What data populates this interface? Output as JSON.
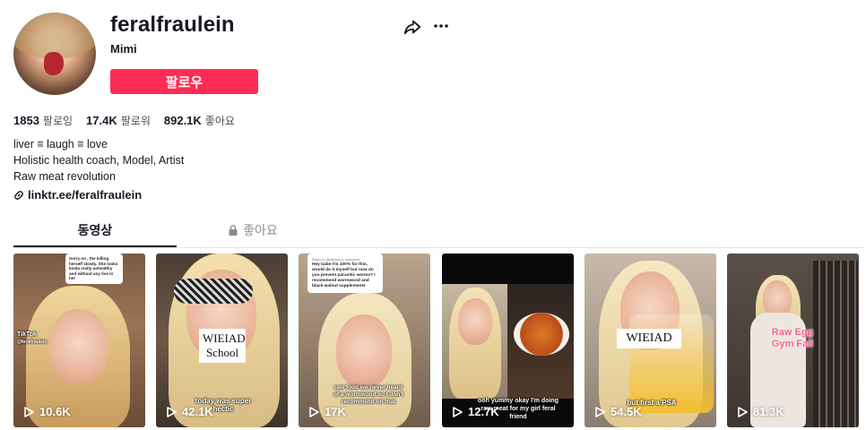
{
  "profile": {
    "username": "feralfraulein",
    "nickname": "Mimi",
    "follow_label": "팔로우"
  },
  "stats": {
    "following": {
      "value": "1853",
      "label": "팔로잉"
    },
    "followers": {
      "value": "17.4K",
      "label": "팔로워"
    },
    "likes": {
      "value": "892.1K",
      "label": "좋아요"
    }
  },
  "bio": {
    "line1": "liver ≡ laugh ≡ love",
    "line2": "Holistic health coach, Model, Artist",
    "line3": "Raw meat revolution"
  },
  "link": "linktr.ee/feralfraulein",
  "tabs": {
    "videos": "동영상",
    "liked": "좋아요"
  },
  "icons": {
    "share": "share-icon",
    "more": "more-icon",
    "link": "link-icon",
    "lock": "lock-icon",
    "play": "play-icon"
  },
  "colors": {
    "follow": "#fe2c55",
    "text": "#161823",
    "muted": "#8a8b91"
  },
  "videos": [
    {
      "views": "10.6K",
      "bubble": "Sorry no , the killing herself slowly. She looks kinda really unhealthy and without any live in her",
      "watermark": "TikTok",
      "watermark_handle": "@feralfraulein"
    },
    {
      "views": "42.1K",
      "sign_line1": "WIEIAD",
      "sign_line2": "School",
      "caption": "today was super hectic"
    },
    {
      "views": "17K",
      "bubble_header": "Reply to AllAboutu's comment",
      "bubble": "Hey babe I'm 100% for this, would do it myself but now do you prevent parasitic worms? I recommend wormwood and black walnut supplements",
      "caption": "raw food we never heard of a wormwood so I don't recommend on that"
    },
    {
      "views": "12.7K",
      "caption": "ooh yummy okay I'm doing raw meat for my girl feral friend"
    },
    {
      "views": "54.5K",
      "sign_line1": "WIEIAD",
      "caption": "but first a PSA"
    },
    {
      "views": "81.3K",
      "caption_line1": "Raw Egg",
      "caption_line2": "Gym Fail"
    }
  ]
}
